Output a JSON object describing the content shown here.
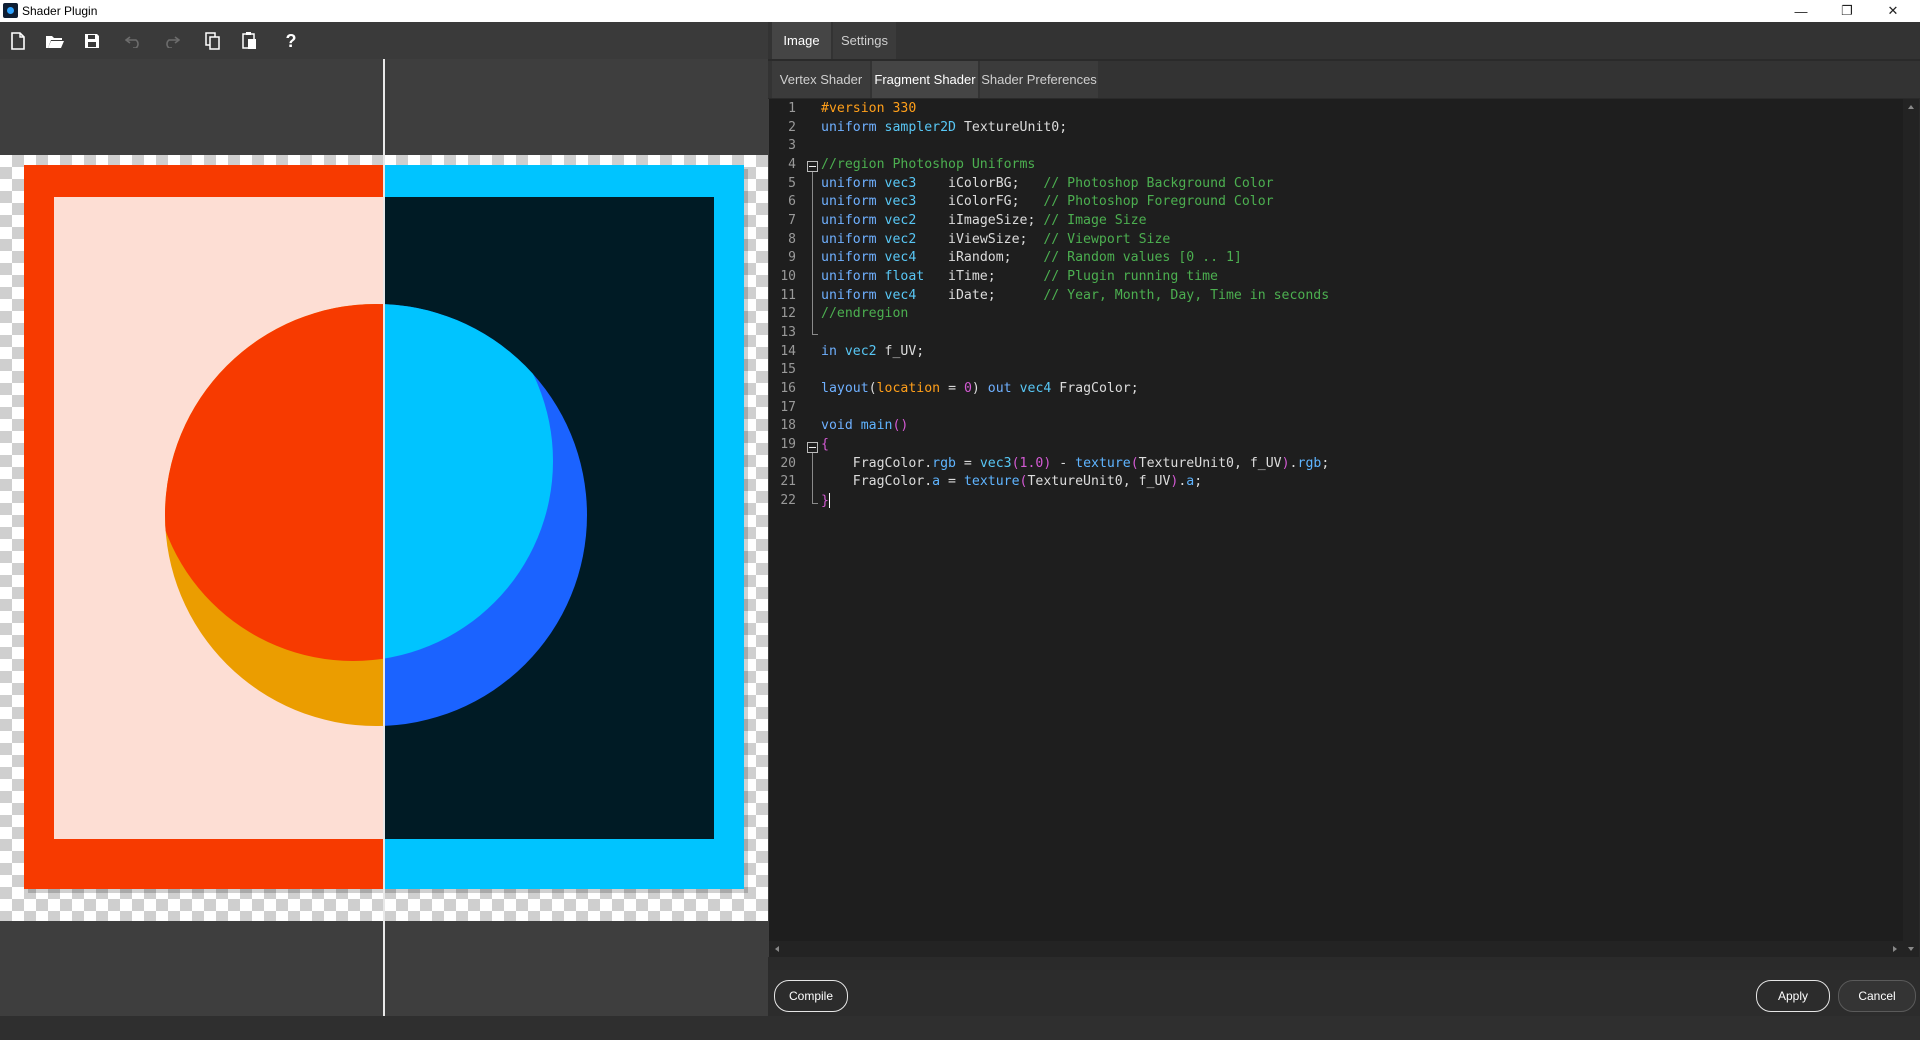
{
  "window": {
    "title": "Shader Plugin",
    "controls": {
      "minimize": "—",
      "maximize": "❐",
      "close": "✕"
    }
  },
  "toolbar": {
    "buttons": [
      "new",
      "open",
      "save",
      "undo",
      "redo",
      "copy",
      "paste",
      "help"
    ],
    "help_label": "?"
  },
  "tabs_top": {
    "image": "Image",
    "settings": "Settings",
    "active": "Image"
  },
  "tabs_shader": {
    "vertex": "Vertex Shader",
    "fragment": "Fragment Shader",
    "preferences": "Shader Preferences",
    "active": "Fragment Shader"
  },
  "code": {
    "line_numbers": [
      "1",
      "2",
      "3",
      "4",
      "5",
      "6",
      "7",
      "8",
      "9",
      "10",
      "11",
      "12",
      "13",
      "14",
      "15",
      "16",
      "17",
      "18",
      "19",
      "20",
      "21",
      "22"
    ]
  },
  "buttons": {
    "compile": "Compile",
    "apply": "Apply",
    "cancel": "Cancel"
  },
  "colors": {
    "red": "#f73a00",
    "cyan": "#00c4ff",
    "orange": "#eb9d00",
    "blue": "#1b63ff",
    "dark": "#001b25",
    "pink": "#fdded4"
  }
}
